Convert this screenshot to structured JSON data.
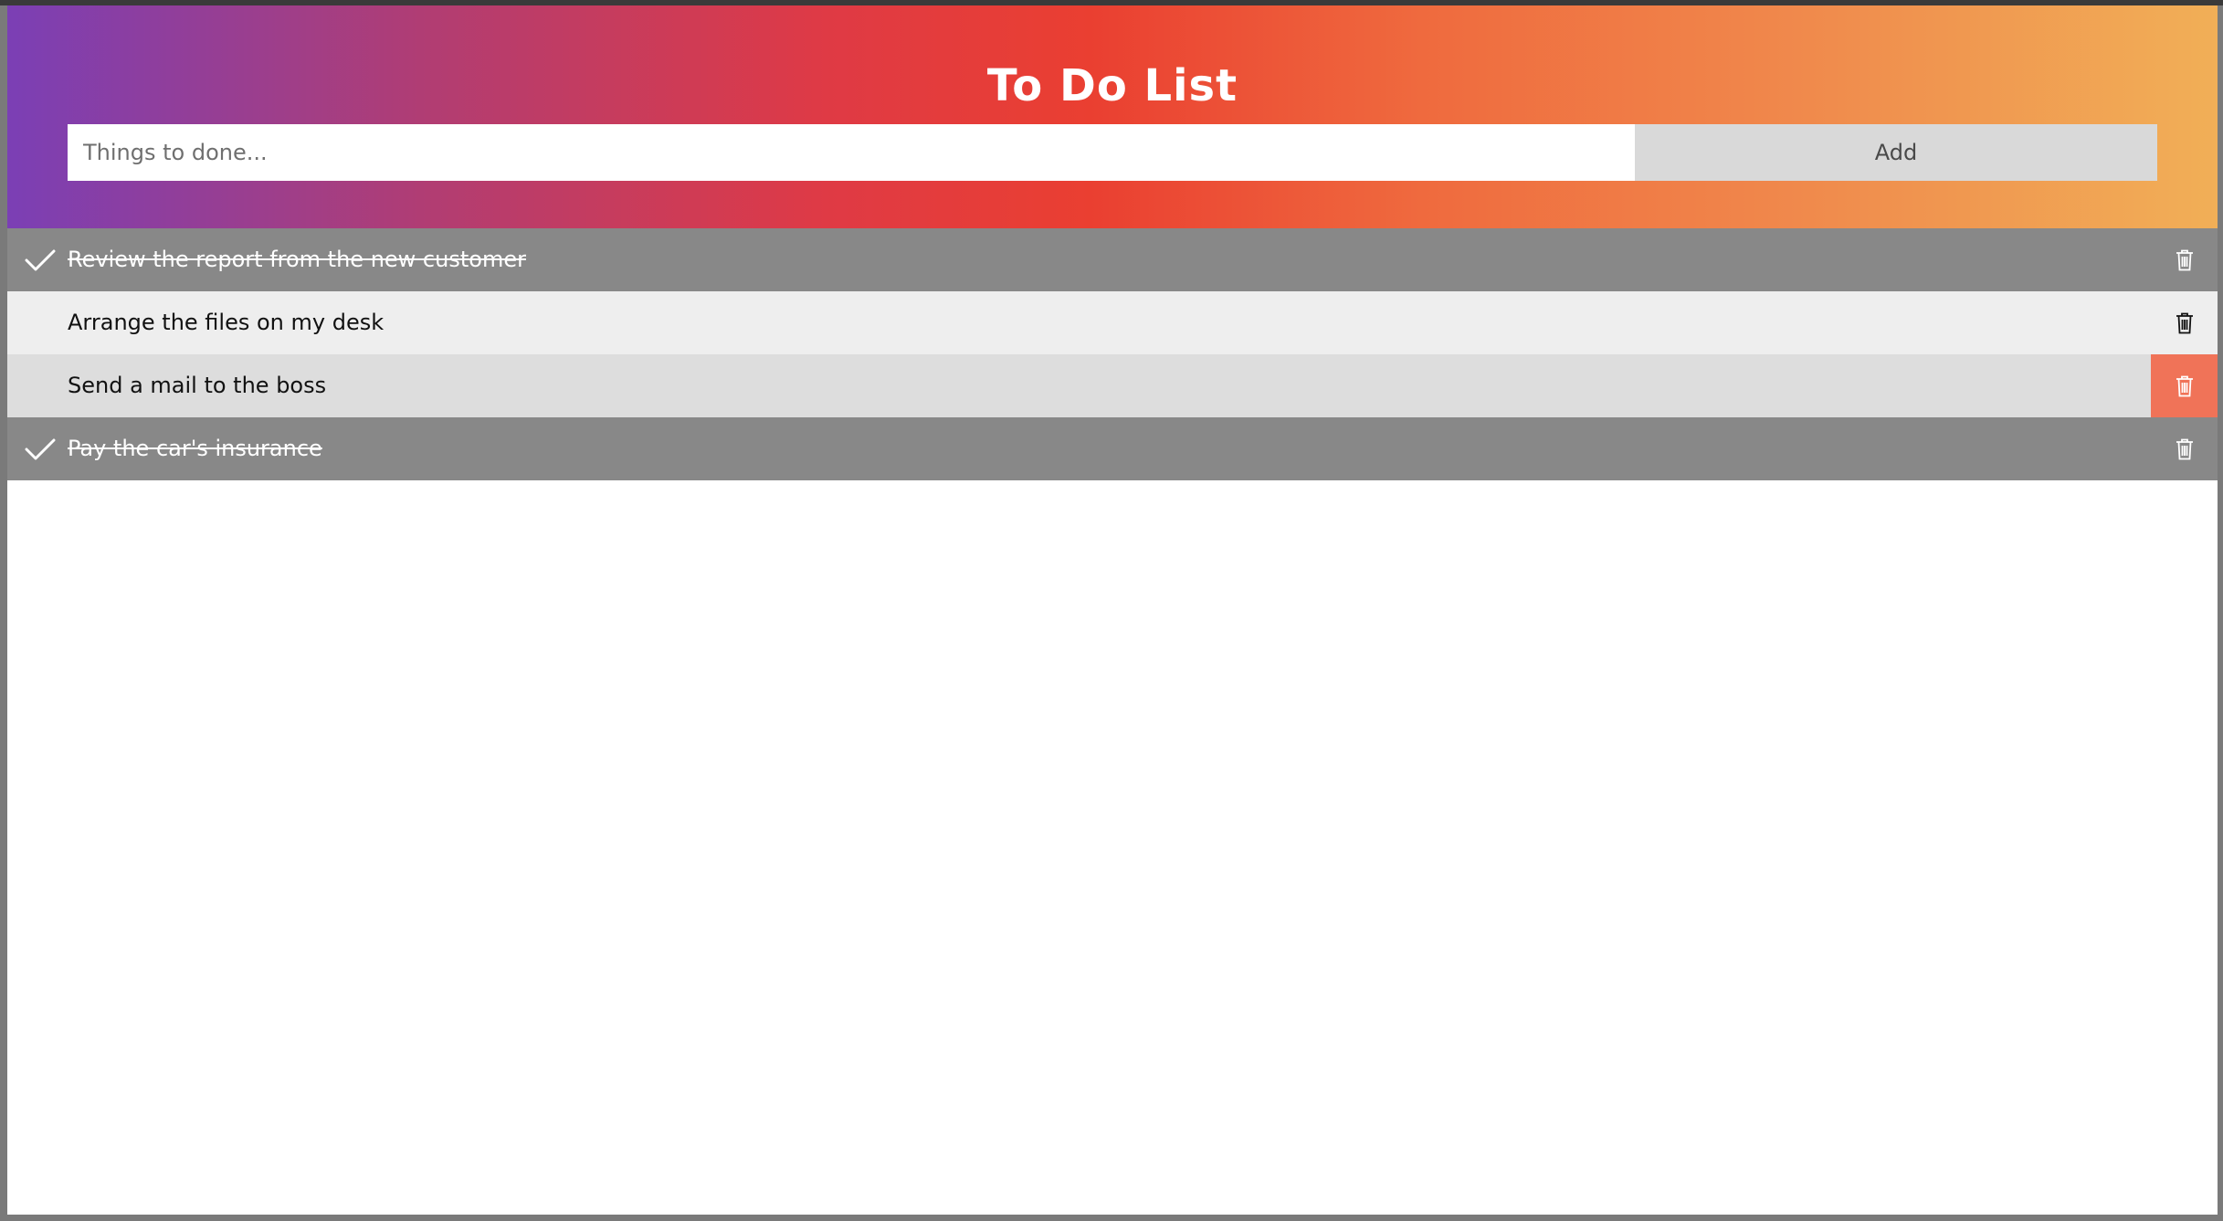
{
  "app": {
    "title": "To Do List"
  },
  "form": {
    "input_value": "",
    "input_placeholder": "Things to done...",
    "add_label": "Add"
  },
  "todos": [
    {
      "text": "Review the report from the new customer",
      "done": true
    },
    {
      "text": "Arrange the files on my desk",
      "done": false
    },
    {
      "text": "Send a mail to the boss",
      "done": false,
      "delete_hovered": true
    },
    {
      "text": "Pay the car's insurance",
      "done": true
    }
  ],
  "icons": {
    "check": "check-icon",
    "delete": "trash-icon"
  },
  "colors": {
    "header_gradient": [
      "#7b3fb5",
      "#ea3f31",
      "#f1af57"
    ],
    "done_row": "#888888",
    "delete_hover": "#f07358",
    "add_button": "#d9d9d9"
  }
}
